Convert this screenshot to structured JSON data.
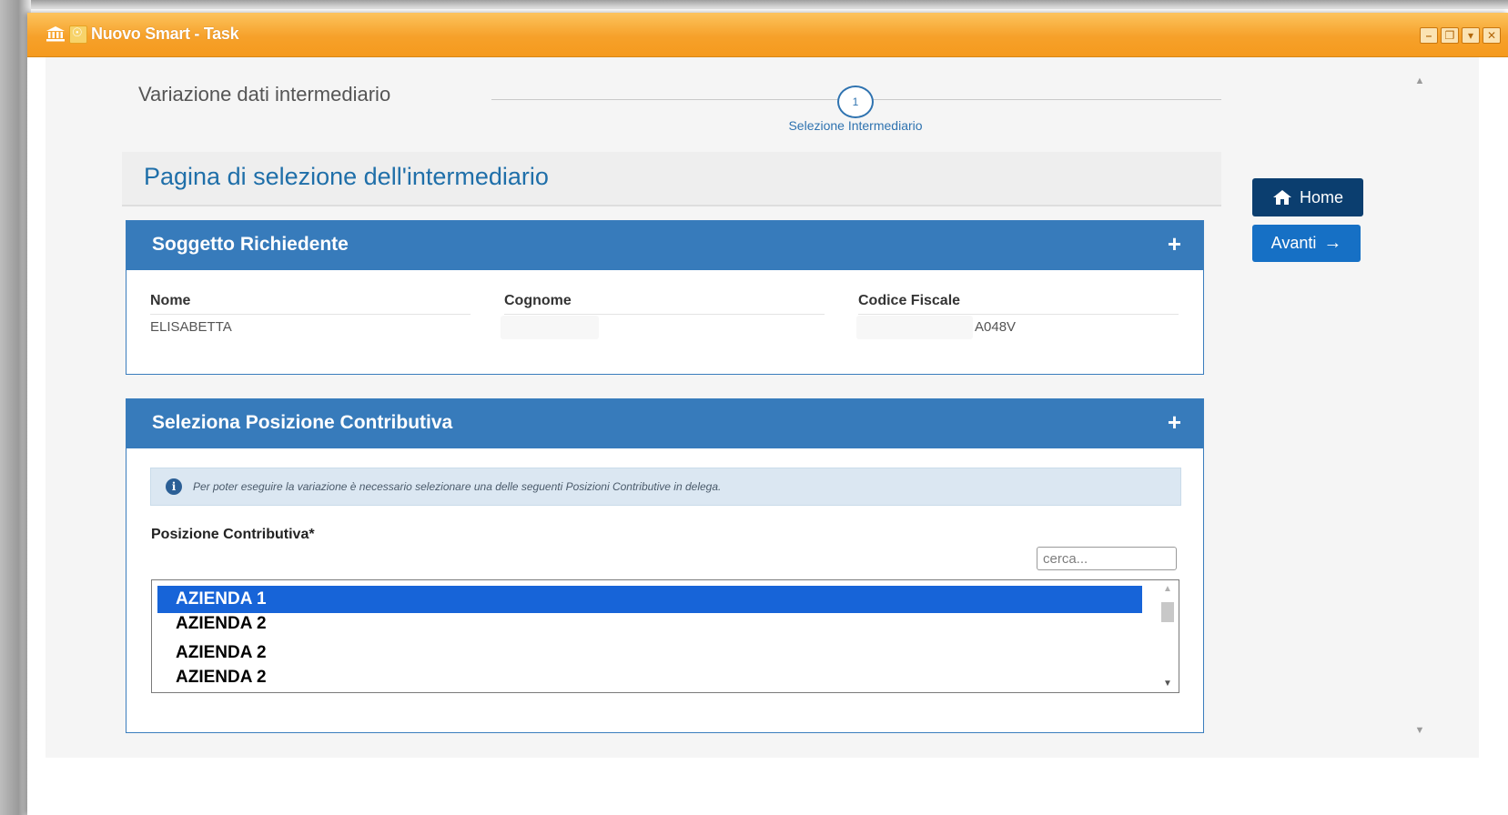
{
  "window": {
    "title": "Nuovo Smart - Task",
    "controls": [
      "minimize",
      "restore",
      "menu",
      "close"
    ]
  },
  "wizard": {
    "title": "Variazione dati intermediario",
    "step_number": "1",
    "step_label": "Selezione Intermediario"
  },
  "page": {
    "title": "Pagina di selezione dell'intermediario"
  },
  "soggetto": {
    "title": "Soggetto Richiedente",
    "expand": "+",
    "nome_label": "Nome",
    "nome_value": "ELISABETTA",
    "cognome_label": "Cognome",
    "cognome_value": "",
    "cf_label": "Codice Fiscale",
    "cf_value": "A048V"
  },
  "posizione": {
    "title": "Seleziona Posizione Contributiva",
    "expand": "+",
    "info_icon": "i",
    "info": "Per poter eseguire la variazione è necessario selezionare una delle seguenti Posizioni Contributive in delega.",
    "field_label": "Posizione Contributiva*",
    "search_placeholder": "cerca...",
    "items": [
      {
        "label": "AZIENDA 1",
        "selected": true
      },
      {
        "label": "AZIENDA 2",
        "selected": false
      },
      {
        "label": "AZIENDA 2",
        "selected": false
      },
      {
        "label": "AZIENDA 2",
        "selected": false
      }
    ]
  },
  "actions": {
    "home": "Home",
    "avanti": "Avanti"
  },
  "colors": {
    "titlebar": "#f6a12a",
    "panel_header": "#377bbb",
    "home_button": "#0b3e6f",
    "avanti_button": "#1670c5",
    "selected_item": "#1764d8"
  }
}
